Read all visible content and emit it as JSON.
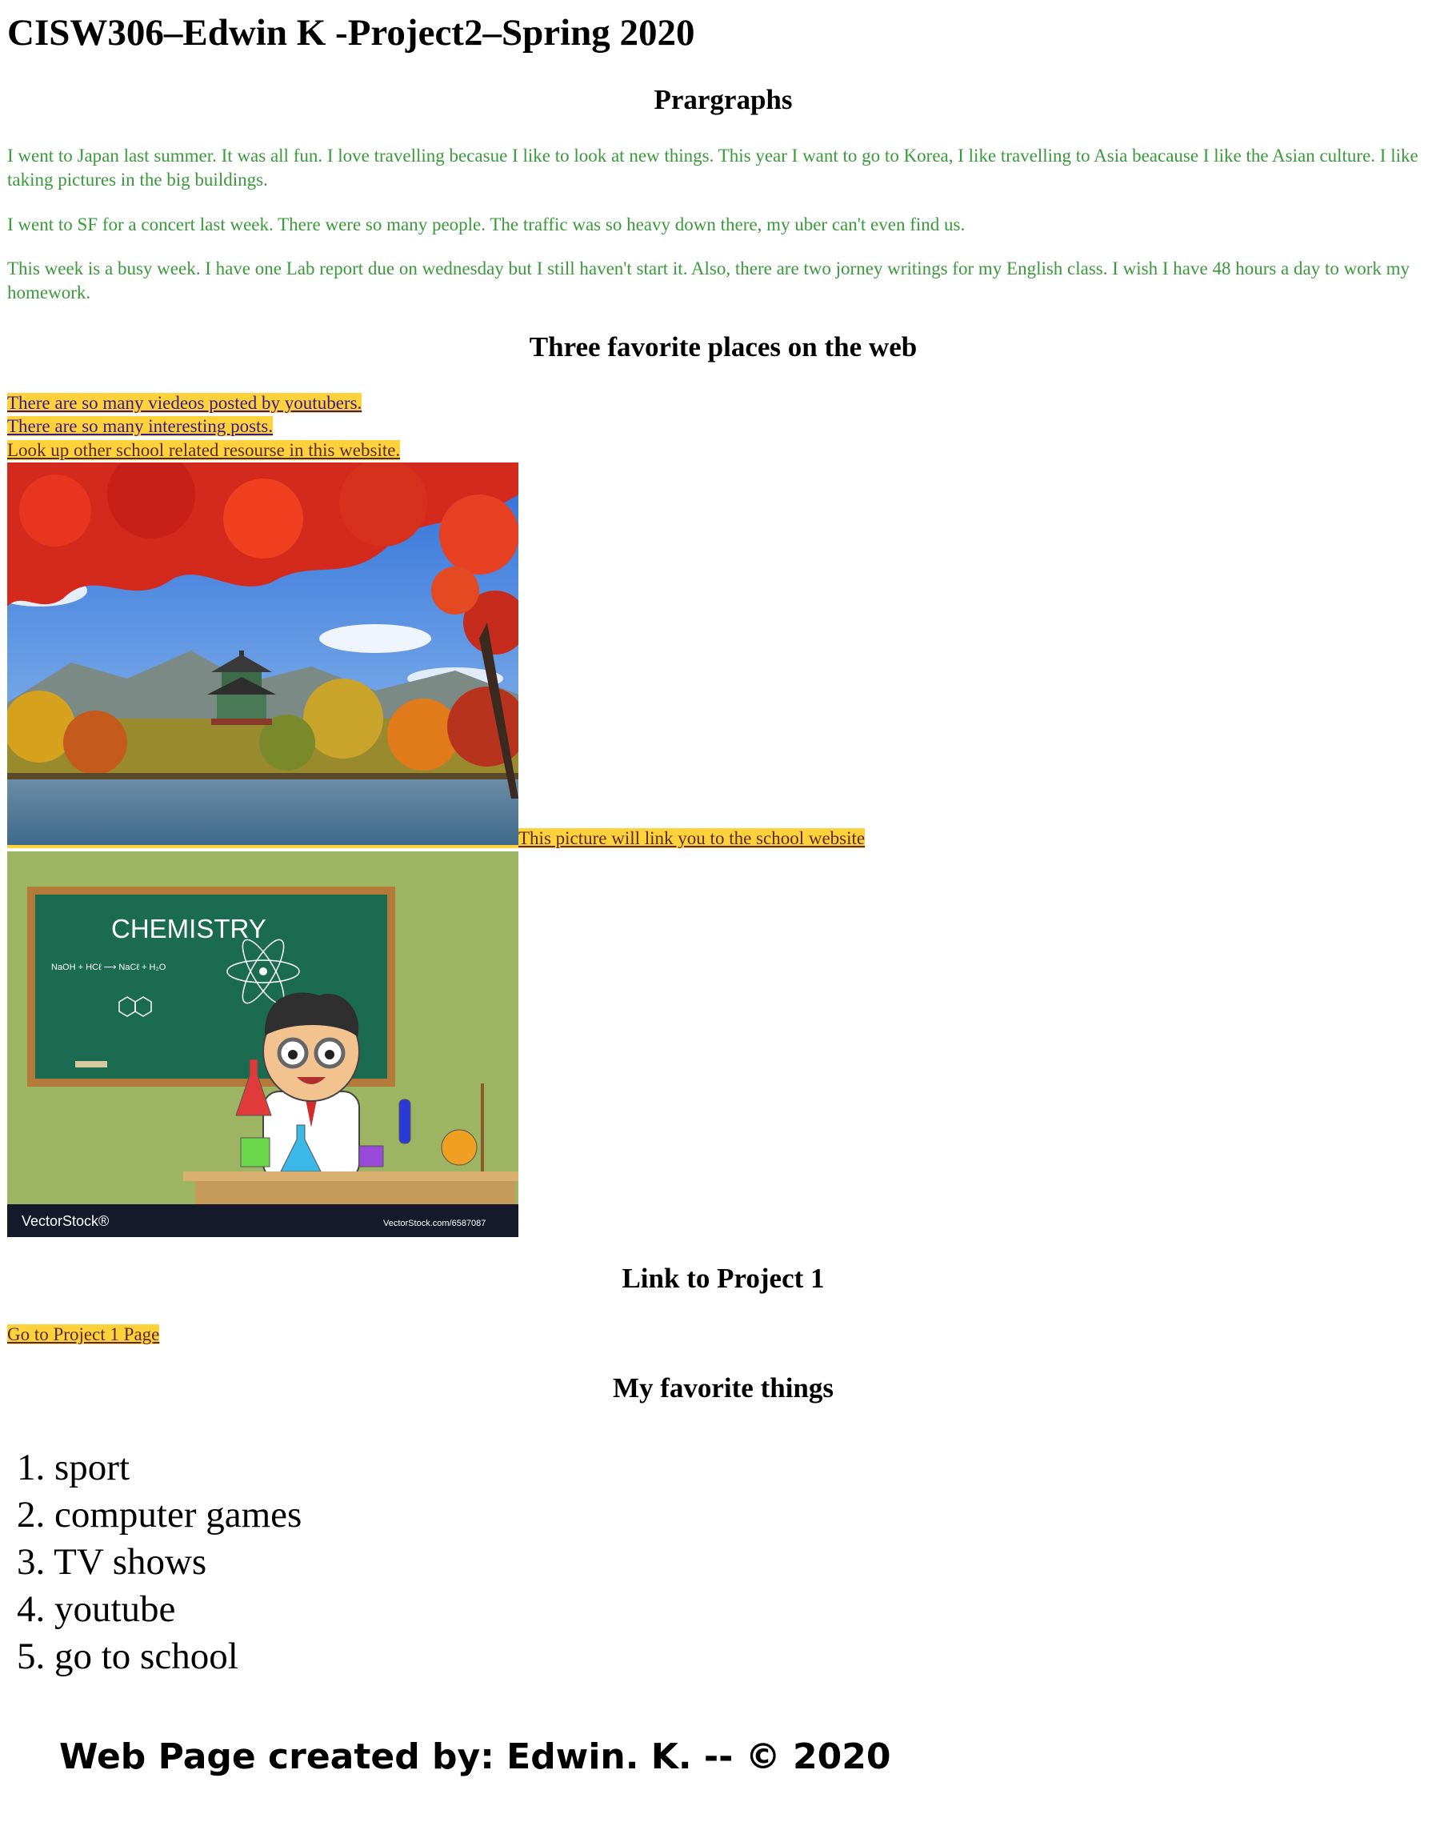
{
  "page": {
    "title": "CISW306–Edwin K -Project2–Spring 2020"
  },
  "paragraphs": {
    "heading": "Prargraphs",
    "items": [
      "I went to Japan last summer. It was all fun. I love travelling becasue I like to look at new things. This year I want to go to Korea, I like travelling to Asia beacause I like the Asian culture. I like taking pictures in the big buildings.",
      "I went to SF for a concert last week. There were so many people. The traffic was so heavy down there, my uber can't even find us.",
      "This week is a busy week. I have one Lab report due on wednesday but I still haven't start it. Also, there are two jorney writings for my English class. I wish I have 48 hours a day to work my homework."
    ]
  },
  "favorites_web": {
    "heading": "Three favorite places on the web",
    "links": [
      "There are so many viedeos posted by youtubers.",
      "There are so many interesting posts.",
      "Look up other school related resourse in this website."
    ],
    "picture_link": "This picture will link you to the school website"
  },
  "chemistry_image": {
    "board_title": "CHEMISTRY",
    "equation": "NaOH + HCℓ ⟶ NaCℓ + H₂O",
    "watermark_left": "VectorStock®",
    "watermark_right": "VectorStock.com/6587087"
  },
  "project1": {
    "heading": "Link to Project 1",
    "link": "Go to Project 1 Page"
  },
  "favorite_things": {
    "heading": "My favorite things",
    "items": [
      "1. sport",
      "2. computer games",
      "3. TV shows",
      "4. youtube",
      "5. go to school"
    ]
  },
  "footer": {
    "text": "Web Page created by: Edwin. K. -- © 2020"
  },
  "colors": {
    "paragraph_text": "#3a9a3a",
    "link_highlight": "#ffd23c",
    "link_text": "#3a1a8a"
  }
}
